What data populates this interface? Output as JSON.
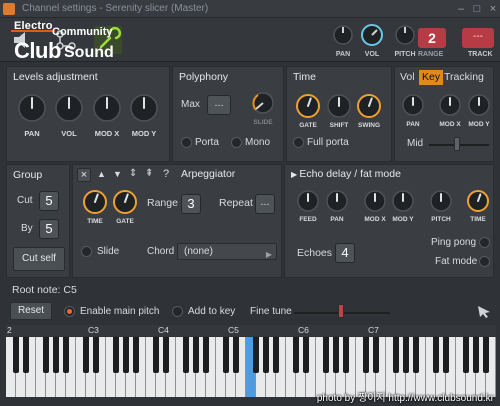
{
  "app": {
    "title": "Channel settings - Serenity slicer (Master)",
    "logo_top": "Electro",
    "logo_sub": "Community",
    "logo_big": "Club",
    "logo_big2": "Sound"
  },
  "toolbar": {
    "pan_label": "PAN",
    "vol_label": "VOL",
    "pitch_label": "PITCH",
    "range_label": "RANGE",
    "range_value": "2",
    "track_label": "TRACK",
    "track_value": "---"
  },
  "levels": {
    "title": "Levels adjustment",
    "knobs": [
      "PAN",
      "VOL",
      "MOD X",
      "MOD Y"
    ]
  },
  "polyphony": {
    "title": "Polyphony",
    "max_label": "Max",
    "max_value": "---",
    "slide_label": "SLIDE",
    "porta_label": "Porta",
    "mono_label": "Mono"
  },
  "time": {
    "title": "Time",
    "knobs": [
      "GATE",
      "SHIFT",
      "SWING"
    ],
    "full_porta_label": "Full porta"
  },
  "tabs": {
    "vol": "Vol",
    "key": "Key",
    "tracking": "Tracking",
    "knobs": [
      "PAN",
      "MOD X",
      "MOD Y"
    ],
    "mid_label": "Mid"
  },
  "group": {
    "title": "Group",
    "cut_label": "Cut",
    "cut_value": "5",
    "by_label": "By",
    "by_value": "5",
    "cut_self_label": "Cut self"
  },
  "arp": {
    "toolbar_icons": [
      "×",
      "▲",
      "▼",
      "⇕",
      "⇞",
      "?"
    ],
    "title": "Arpeggiator",
    "knobs": [
      "TIME",
      "GATE"
    ],
    "range_label": "Range",
    "range_value": "3",
    "repeat_label": "Repeat",
    "repeat_value": "---",
    "slide_label": "Slide",
    "chord_label": "Chord",
    "chord_value": "(none)"
  },
  "echo": {
    "title": "Echo delay / fat mode",
    "knobs": [
      "FEED",
      "PAN",
      "MOD X",
      "MOD Y",
      "PITCH",
      "TIME"
    ],
    "echoes_label": "Echoes",
    "echoes_value": "4",
    "pingpong_label": "Ping pong",
    "fatmode_label": "Fat mode"
  },
  "rootnote": {
    "label": "Root note: C5",
    "reset_label": "Reset",
    "enable_pitch_label": "Enable main pitch",
    "add_key_label": "Add to key",
    "fine_tune_label": "Fine tune"
  },
  "keyboard": {
    "octaves": [
      "2",
      "C3",
      "C4",
      "C5",
      "C6",
      "C7"
    ],
    "selected_key": "C5"
  },
  "watermark": "photo by 짱이지 http://www.clubsound.kr",
  "colors": {
    "accent": "#f0a030",
    "red_badge": "#b63b44",
    "key_highlight": "#4f9be0"
  }
}
